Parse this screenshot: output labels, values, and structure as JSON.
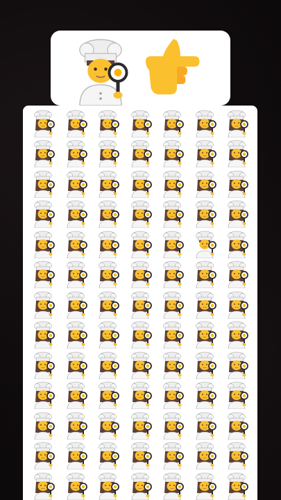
{
  "puzzle": {
    "target_emoji": "man-cook",
    "pointer_emoji": "backhand-index-pointing-right",
    "grid_emoji": "woman-cook",
    "odd_one_out_emoji": "man-cook",
    "rows": 13,
    "columns": 7,
    "odd_one_out_position": {
      "row": 5,
      "column": 6
    }
  },
  "colors": {
    "background": "#0d0a0b",
    "card": "#ffffff",
    "skin": "#fbc02d",
    "hair": "#5d4037",
    "hat": "#eeeeee",
    "uniform": "#f5f5f5",
    "pan": "#2b2b2b",
    "egg_yolk": "#ffb300"
  }
}
